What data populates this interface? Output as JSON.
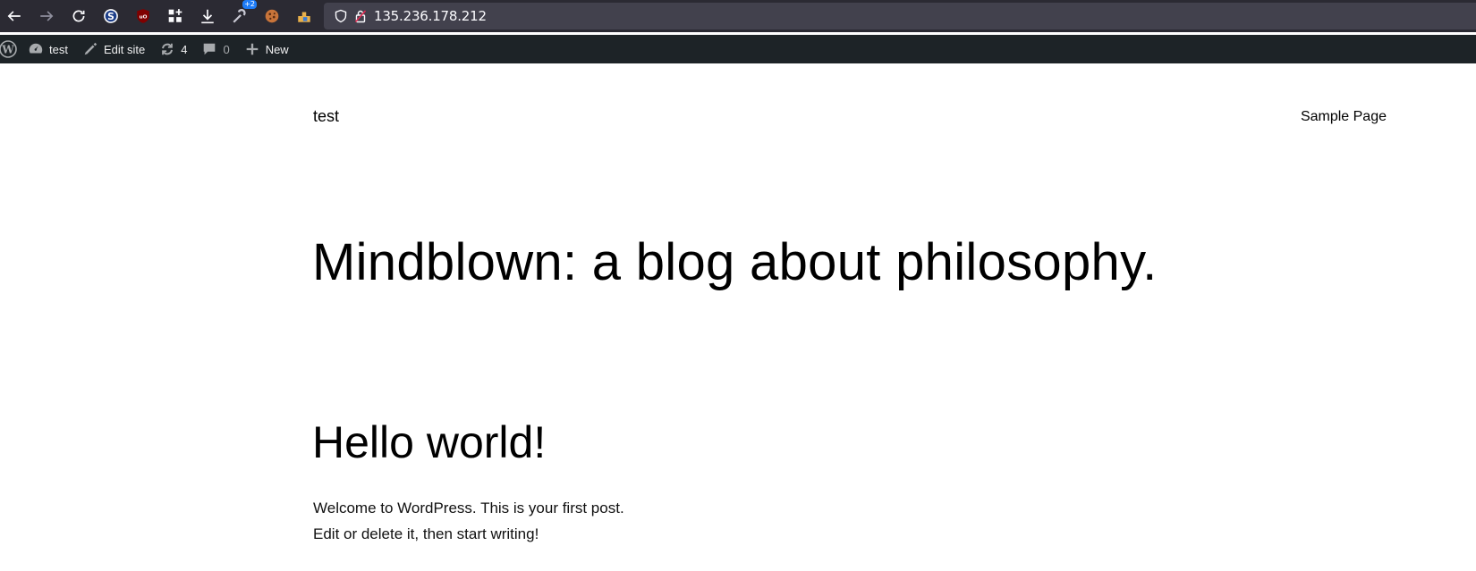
{
  "browser": {
    "url": "135.236.178.212",
    "extension_badge": "+2",
    "toolbar_icons": [
      "back-icon",
      "forward-icon",
      "reload-icon",
      "s-extension-icon",
      "ublock-icon",
      "extensions-grid-icon",
      "download-icon",
      "multi-extension-icon",
      "cookie-icon",
      "puzzle-extension-icon"
    ]
  },
  "admin_bar": {
    "site_name": "test",
    "edit_site": "Edit site",
    "updates_count": "4",
    "comments_count": "0",
    "new_label": "New"
  },
  "site": {
    "title": "test",
    "nav": [
      "Sample Page"
    ]
  },
  "main": {
    "tagline": "Mindblown: a blog about philosophy.",
    "post": {
      "title": "Hello world!",
      "excerpt_line1": "Welcome to WordPress. This is your first post.",
      "excerpt_line2": "Edit or delete it, then start writing!"
    }
  }
}
